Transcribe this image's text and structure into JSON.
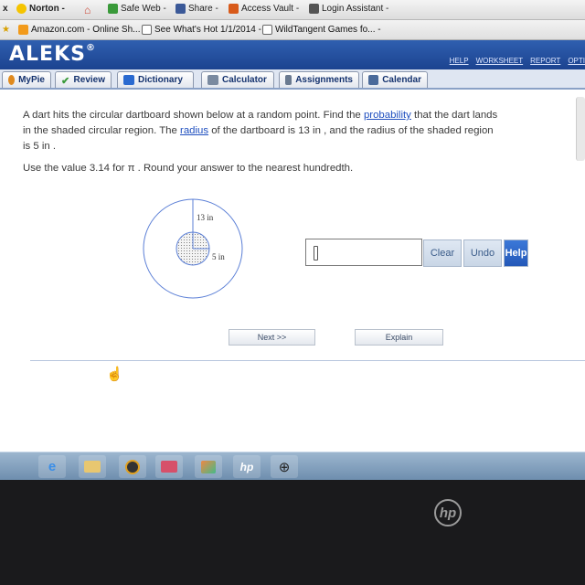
{
  "toolbar1": {
    "close_glyph": "x",
    "norton": "Norton -",
    "safeweb": "Safe Web -",
    "share": "Share -",
    "access_vault": "Access Vault -",
    "login_assistant": "Login Assistant -"
  },
  "toolbar2": {
    "amazon": "Amazon.com - Online Sh...",
    "whatshot": "See What's Hot 1/1/2014 -",
    "wildtangent": "WildTangent Games fo... -"
  },
  "aleks": {
    "logo": "ALEKS",
    "links": [
      "HELP",
      "WORKSHEET",
      "REPORT",
      "OPTI"
    ]
  },
  "nav": {
    "tabs": [
      {
        "label": "MyPie",
        "color": "#e08a1e"
      },
      {
        "label": "Review",
        "color": "#3a9a3a"
      },
      {
        "label": "Dictionary",
        "color": "#2a6ad0"
      },
      {
        "label": "Calculator",
        "color": "#7a8aa0"
      },
      {
        "label": "Assignments",
        "color": "#6a7a90"
      },
      {
        "label": "Calendar",
        "color": "#4a6a9a"
      }
    ]
  },
  "problem": {
    "p1": "A dart hits the circular dartboard shown below at a random point. Find the ",
    "probability": "probability",
    "p2": " that the dart lands in the shaded circular region. The ",
    "radius": "radius",
    "p3": " of the dartboard is 13 in , and the radius of the shaded region is 5 in .",
    "instruction": "Use the value 3.14 for π . Round your answer to the nearest hundredth."
  },
  "figure": {
    "outer_label": "13 in",
    "inner_label": "5 in"
  },
  "answer": {
    "value": "",
    "clear": "Clear",
    "undo": "Undo",
    "help": "Help"
  },
  "actions": {
    "next": "Next >>",
    "explain": "Explain"
  },
  "taskbar": {
    "icons": [
      "ie-icon",
      "folder-icon",
      "media-player-icon",
      "media-center-icon",
      "photo-gallery-icon",
      "hp-icon",
      "network-icon"
    ]
  },
  "brand": "hp"
}
